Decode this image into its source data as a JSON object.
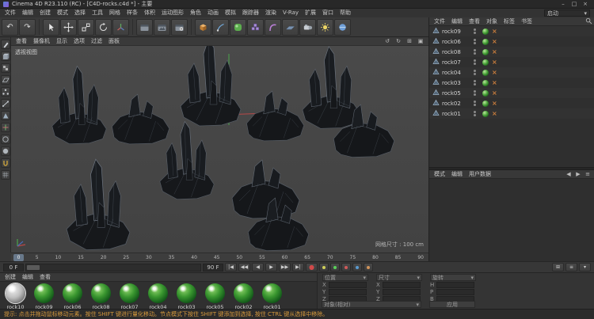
{
  "window": {
    "title": "Cinema 4D R23.110 (RC) - [C4D-rocks.c4d *] - 主要"
  },
  "icons": {
    "minimize": "–",
    "maximize": "□",
    "close": "×",
    "undo": "↶",
    "redo": "↷",
    "dropdown": "▾",
    "menu": "≡",
    "grid": "⊞",
    "view_reset": "↺",
    "view_redo": "↻",
    "view_layout": "⊞",
    "view_toggle": "▣",
    "am_back": "◀",
    "am_forward": "▶",
    "tag_x": "×"
  },
  "menu_bar": {
    "items": [
      "文件",
      "编辑",
      "创建",
      "模式",
      "选择",
      "工具",
      "网格",
      "样条",
      "体积",
      "运动图形",
      "角色",
      "动画",
      "模拟",
      "跟踪器",
      "渲染",
      "V-Ray",
      "扩展",
      "窗口",
      "帮助"
    ],
    "layout_value": "启动"
  },
  "viewport": {
    "menu": [
      "查看",
      "摄像机",
      "显示",
      "选项",
      "过滤",
      "面板"
    ],
    "label": "透视视图",
    "grid_size": "网格尺寸 : 100 cm"
  },
  "object_manager": {
    "menu": [
      "文件",
      "编辑",
      "查看",
      "对象",
      "标签",
      "书签"
    ],
    "objects": [
      {
        "name": "rock09"
      },
      {
        "name": "rock06"
      },
      {
        "name": "rock08"
      },
      {
        "name": "rock07"
      },
      {
        "name": "rock04"
      },
      {
        "name": "rock03"
      },
      {
        "name": "rock05"
      },
      {
        "name": "rock02"
      },
      {
        "name": "rock01"
      }
    ]
  },
  "attribute_manager": {
    "menu": [
      "模式",
      "编辑",
      "用户数据"
    ]
  },
  "timeline": {
    "ticks": [
      "0",
      "5",
      "10",
      "15",
      "20",
      "25",
      "30",
      "35",
      "40",
      "45",
      "50",
      "55",
      "60",
      "65",
      "70",
      "75",
      "80",
      "85",
      "90"
    ],
    "playhead": "0",
    "start_field": "0 F",
    "end_field": "90 F",
    "nav": [
      "|◀",
      "◀◀",
      "◀",
      "▶",
      "▶▶",
      "▶|"
    ],
    "record": "●"
  },
  "material_manager": {
    "menu": [
      "创建",
      "编辑",
      "查看"
    ],
    "materials": [
      {
        "name": "rock10"
      },
      {
        "name": "rock09"
      },
      {
        "name": "rock06"
      },
      {
        "name": "rock08"
      },
      {
        "name": "rock07"
      },
      {
        "name": "rock04"
      },
      {
        "name": "rock03"
      },
      {
        "name": "rock05"
      },
      {
        "name": "rock02"
      },
      {
        "name": "rock01"
      }
    ]
  },
  "coordinates": {
    "columns": [
      {
        "title": "位置",
        "rows": [
          {
            "label": "X",
            "value": ""
          },
          {
            "label": "Y",
            "value": ""
          },
          {
            "label": "Z",
            "value": ""
          }
        ]
      },
      {
        "title": "尺寸",
        "rows": [
          {
            "label": "X",
            "value": ""
          },
          {
            "label": "Y",
            "value": ""
          },
          {
            "label": "Z",
            "value": ""
          }
        ]
      },
      {
        "title": "旋转",
        "rows": [
          {
            "label": "H",
            "value": ""
          },
          {
            "label": "P",
            "value": ""
          },
          {
            "label": "B",
            "value": ""
          }
        ]
      }
    ],
    "mode": "对象(相对)",
    "apply": "应用"
  },
  "status_bar": {
    "hint": "提示: 点击并拖动鼠标移动元素。按住 SHIFT 键进行量化移动。节点模式下按住 SHIFT 键添加到选择, 按住 CTRL 键从选择中移除。"
  },
  "colors": {
    "material_green": "#39962f",
    "material_light": "#bdbdbd",
    "viewport_bg": "#464646",
    "hint_text": "#d79a3c",
    "axis_green": "#4aa54a",
    "axis_red": "#b84848"
  }
}
